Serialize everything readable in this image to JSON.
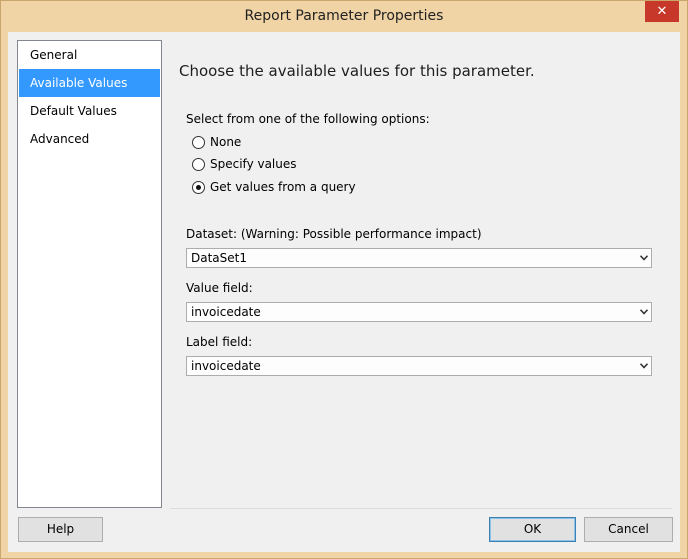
{
  "window": {
    "title": "Report Parameter Properties",
    "close_glyph": "✕"
  },
  "nav": {
    "items": [
      {
        "label": "General"
      },
      {
        "label": "Available Values"
      },
      {
        "label": "Default Values"
      },
      {
        "label": "Advanced"
      }
    ],
    "selected": "Available Values"
  },
  "panel": {
    "heading": "Choose the available values for this parameter.",
    "options_label": "Select from one of the following options:",
    "options": [
      {
        "label": "None",
        "checked": false
      },
      {
        "label": "Specify values",
        "checked": false
      },
      {
        "label": "Get values from a query",
        "checked": true
      }
    ],
    "dataset_label": "Dataset: (Warning: Possible performance impact)",
    "dataset_value": "DataSet1",
    "value_field_label": "Value field:",
    "value_field_value": "invoicedate",
    "label_field_label": "Label field:",
    "label_field_value": "invoicedate"
  },
  "buttons": {
    "help": "Help",
    "ok": "OK",
    "cancel": "Cancel"
  },
  "colors": {
    "title_bar": "#f0d4a6",
    "selection": "#3399ff",
    "close_button": "#c7372a"
  }
}
